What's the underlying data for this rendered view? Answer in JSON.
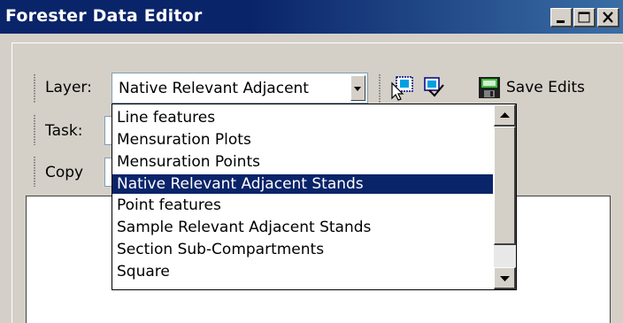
{
  "window": {
    "title": "Forester Data Editor"
  },
  "toolbar": {
    "layer_label": "Layer:",
    "layer_selected": "Native Relevant Adjacent",
    "task_label": "Task:",
    "copy_label": "Copy",
    "save_label": "Save Edits",
    "task_value_partial": "",
    "copy_value_partial": ""
  },
  "layer_dropdown": {
    "items": [
      "Line features",
      "Mensuration Plots",
      "Mensuration Points",
      "Native Relevant Adjacent Stands",
      "Point features",
      "Sample Relevant Adjacent Stands",
      "Section Sub-Compartments",
      "Square"
    ],
    "selected_index": 3
  },
  "icons": {
    "select_tool": "select-features-icon",
    "clear_tool": "clear-selection-icon",
    "save": "save-disk-icon"
  },
  "colors": {
    "title_bar": "#0a246a",
    "selection": "#0a246a",
    "face": "#d4d0c8"
  }
}
